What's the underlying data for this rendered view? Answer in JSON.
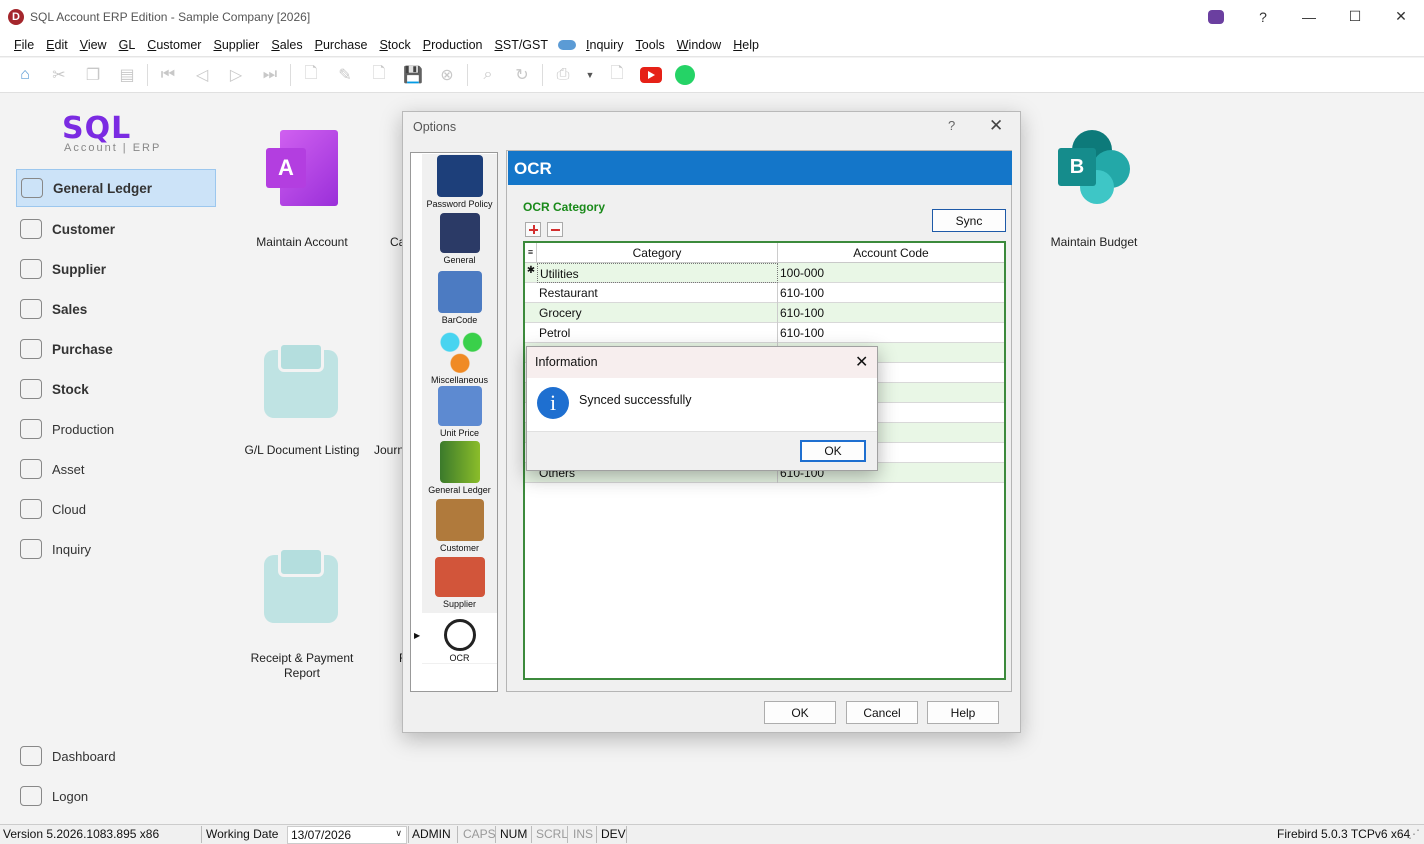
{
  "window": {
    "title": "SQL Account ERP Edition - Sample Company [2026]",
    "logo_letter": "D",
    "help": "?",
    "minimize": "—",
    "maximize": "☐",
    "close": "✕"
  },
  "menu": [
    "File",
    "Edit",
    "View",
    "GL",
    "Customer",
    "Supplier",
    "Sales",
    "Purchase",
    "Stock",
    "Production",
    "SST/GST",
    "Inquiry",
    "Tools",
    "Window",
    "Help"
  ],
  "brand": {
    "name": "SQL",
    "sub": "Account | ERP"
  },
  "sidebar": {
    "items": [
      {
        "label": "General Ledger",
        "icon": "ledger-icon"
      },
      {
        "label": "Customer",
        "icon": "customer-icon"
      },
      {
        "label": "Supplier",
        "icon": "supplier-icon"
      },
      {
        "label": "Sales",
        "icon": "sales-icon"
      },
      {
        "label": "Purchase",
        "icon": "cart-icon"
      },
      {
        "label": "Stock",
        "icon": "stock-icon"
      },
      {
        "label": "Production",
        "icon": "production-icon"
      },
      {
        "label": "Asset",
        "icon": "asset-icon"
      },
      {
        "label": "Cloud",
        "icon": "cloud-icon"
      },
      {
        "label": "Inquiry",
        "icon": "inquiry-icon"
      },
      {
        "label": "Dashboard",
        "icon": "dashboard-icon"
      },
      {
        "label": "Logon",
        "icon": "logon-icon"
      }
    ]
  },
  "desktop": {
    "maintain_account": "Maintain Account",
    "partial_ca": "Ca",
    "gl_doc_listing": "G/L Document Listing",
    "partial_journ": "Journ",
    "receipt_payment": "Receipt & Payment\nReport",
    "partial_f": "F",
    "maintain_budget": "Maintain Budget",
    "tile_a_letter": "A",
    "tile_b_letter": "B"
  },
  "options": {
    "title": "Options",
    "help": "?",
    "close": "✕",
    "categories": [
      "Password Policy",
      "General",
      "BarCode",
      "Miscellaneous",
      "Unit Price",
      "General Ledger",
      "Customer",
      "Supplier",
      "OCR"
    ],
    "banner": "OCR",
    "section_title": "OCR Category",
    "sync_button": "Sync",
    "grid": {
      "columns": [
        "Category",
        "Account Code"
      ],
      "rows": [
        {
          "category": "Utilities",
          "account": "100-000"
        },
        {
          "category": "Restaurant",
          "account": "610-100"
        },
        {
          "category": "Grocery",
          "account": "610-100"
        },
        {
          "category": "Petrol",
          "account": "610-100"
        },
        {
          "category": "Others",
          "account": "610-100"
        }
      ]
    },
    "buttons": {
      "ok": "OK",
      "cancel": "Cancel",
      "help": "Help"
    }
  },
  "info": {
    "title": "Information",
    "close": "✕",
    "message": "Synced successfully",
    "icon_glyph": "i",
    "ok": "OK"
  },
  "status": {
    "version": "Version 5.2026.1083.895 x86",
    "working_date_label": "Working Date",
    "working_date": "13/07/2026",
    "admin": "ADMIN",
    "caps": "CAPS",
    "num": "NUM",
    "scrl": "SCRL",
    "ins": "INS",
    "dev": "DEV",
    "db": "Firebird 5.0.3 TCPv6 x64"
  }
}
